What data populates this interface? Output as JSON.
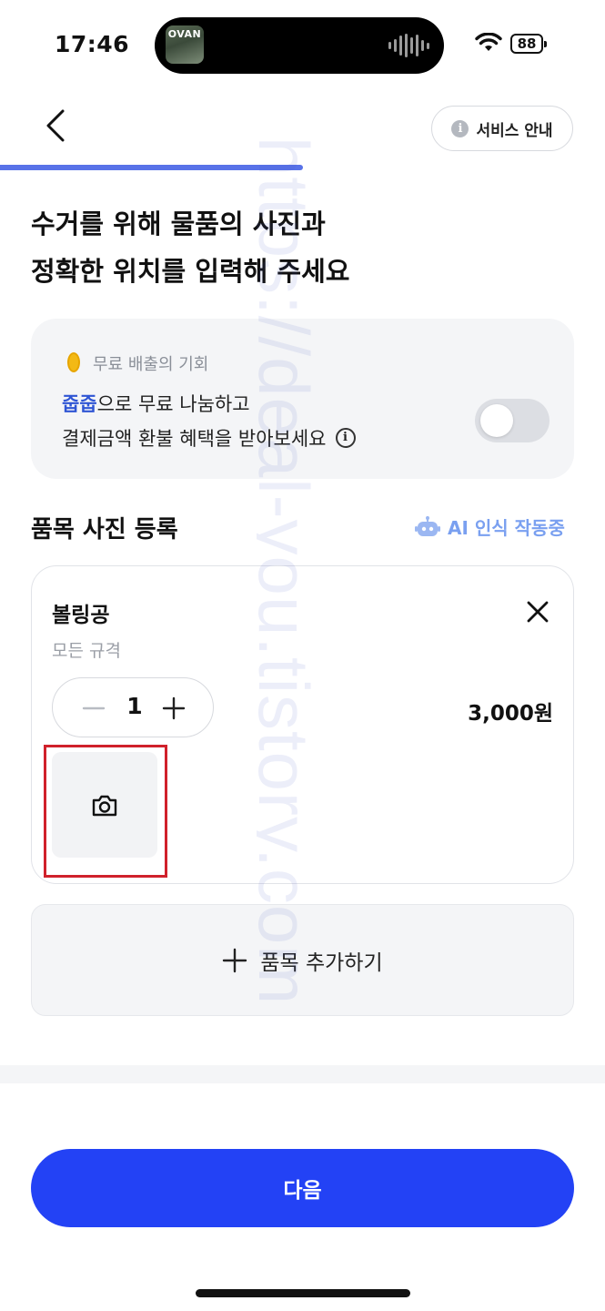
{
  "status_bar": {
    "time": "17:46",
    "now_playing_art_text": "OVAN",
    "battery": "88"
  },
  "header": {
    "back_icon": "chevron-left-icon",
    "service_info_label": "서비스 안내",
    "progress": 0.5
  },
  "title": {
    "line1": "수거를 위해 물품의 사진과",
    "line2": "정확한 위치를 입력해 주세요"
  },
  "free_disposal": {
    "label": "무료 배출의 기회",
    "brand": "줍줍",
    "line1_rest": "으로 무료 나눔하고",
    "line2": "결제금액 환불 혜택을 받아보세요",
    "toggle_on": false
  },
  "section": {
    "title": "품목 사진 등록",
    "ai_status": "AI 인식 작동중"
  },
  "item": {
    "name": "볼링공",
    "spec": "모든 규격",
    "quantity": "1",
    "price": "3,000원"
  },
  "add_item_label": "품목 추가하기",
  "next_button_label": "다음",
  "watermark": "https://deal-you.tistory.com",
  "colors": {
    "accent": "#2342f5",
    "progress": "#5872e8",
    "brand_text": "#2f55d4",
    "ai_text": "#7aa0f0",
    "highlight_box": "#d0212b"
  }
}
